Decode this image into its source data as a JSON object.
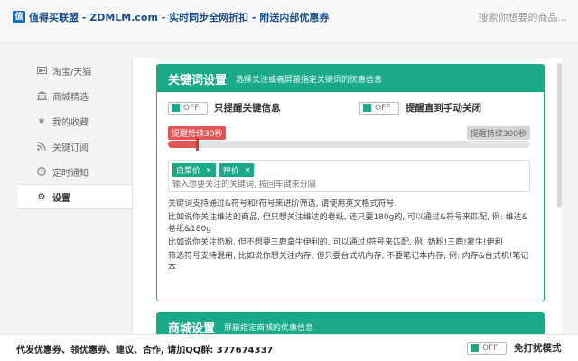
{
  "header": {
    "logo_char": "值",
    "brand": "值得买联盟 - ZDMLM.com - 实时同步全网折扣 - 附送内部优惠券",
    "search_placeholder": "搜索你想要的商品..."
  },
  "sidebar": {
    "items": [
      {
        "label": "淘宝/天猫",
        "icon": "taobao-icon"
      },
      {
        "label": "商城精选",
        "icon": "bank-icon"
      },
      {
        "label": "我的收藏",
        "icon": "star-icon"
      },
      {
        "label": "关键订阅",
        "icon": "rss-icon"
      },
      {
        "label": "定时通知",
        "icon": "clock-icon"
      },
      {
        "label": "设置",
        "icon": "gear-icon"
      }
    ],
    "active_index": 5
  },
  "keyword_panel": {
    "title": "关键词设置",
    "subtitle": "选择关注或者屏蔽指定关键词的优惠信息",
    "toggle1": {
      "state": "OFF",
      "label": "只提醒关键信息"
    },
    "toggle2": {
      "state": "OFF",
      "label": "提醒直到手动关闭"
    },
    "slider": {
      "min_label": "提醒持续30秒",
      "max_label": "提醒持续300秒",
      "value_fraction": 0.08
    },
    "tags": [
      "白菜价",
      "神价"
    ],
    "input_placeholder": "输入想要关注的关键词, 按回车键来分隔",
    "help": [
      "关键词支持通过&符号和!符号来进阶筛选, 请使用英文格式符号.",
      "比如说你关注维达的商品, 但只想关注维达的卷纸, 还只要180g的, 可以通过&符号来匹配, 例: 维达&卷纸&180g",
      "比如说你关注奶粉, 但不想要三鹿拿牛伊利的, 可以通过!符号来匹配, 例: 奶粉!三鹿!蒙牛!伊利",
      "筛选符号支持混用, 比如说你想关注内存, 但只要台式机内存, 不要笔记本内存, 例: 内存&台式机!笔记本"
    ]
  },
  "mall_panel": {
    "title": "商城设置",
    "subtitle": "屏蔽指定商城的优惠信息"
  },
  "footer": {
    "text": "代发优惠券、领优惠券、建议、合作, 请加QQ群: 377674337",
    "toggle_state": "OFF",
    "toggle_label": "免打扰模式"
  },
  "colors": {
    "accent": "#1aaa8a",
    "slider": "#e35454"
  }
}
